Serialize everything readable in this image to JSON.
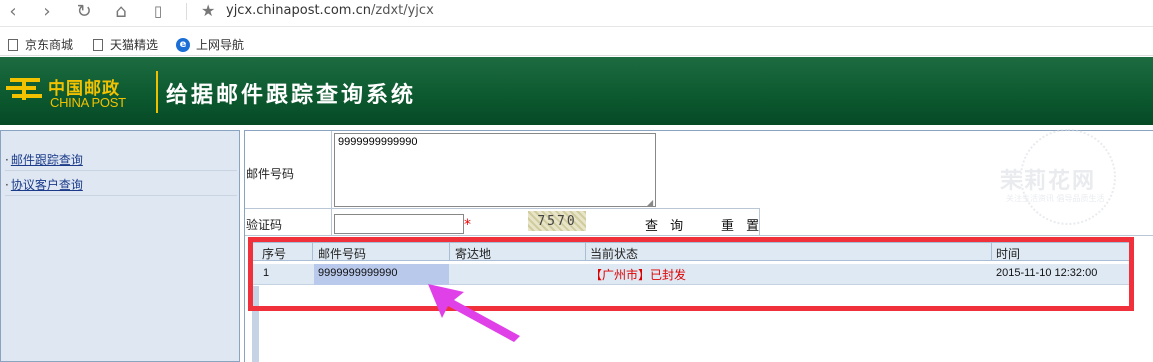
{
  "browser": {
    "url_host": "yjcx.chinapost.com.cn",
    "url_path": "/zdxt/yjcx",
    "bookmarks": [
      "京东商城",
      "天猫精选",
      "上网导航"
    ]
  },
  "banner": {
    "logo_cn": "中国邮政",
    "logo_en": "CHINA POST",
    "title": "给据邮件跟踪查询系统"
  },
  "sidebar": {
    "items": [
      {
        "label": "邮件跟踪查询"
      },
      {
        "label": "协议客户查询"
      }
    ]
  },
  "form": {
    "mail_no_label": "邮件号码",
    "mail_no_value": "9999999999990",
    "captcha_label": "验证码",
    "captcha_value": "",
    "required_mark": "*",
    "captcha_image_text": "7570",
    "query_button": "查 询",
    "reset_button": "重 置"
  },
  "results": {
    "columns": [
      "序号",
      "邮件号码",
      "寄达地",
      "当前状态",
      "时间"
    ],
    "rows": [
      {
        "index": "1",
        "mail_no": "9999999999990",
        "destination": "",
        "status": "【广州市】已封发",
        "time": "2015-11-10 12:32:00"
      }
    ]
  },
  "watermark": {
    "text": "茉莉花网",
    "subtitle": "关注生活资讯 倡导品质生活"
  },
  "colors": {
    "banner_green": "#0d5a30",
    "brand_yellow": "#f2c200",
    "annotation_red": "#f0303a",
    "arrow_magenta": "#e040e8",
    "status_red": "#dd0000"
  }
}
